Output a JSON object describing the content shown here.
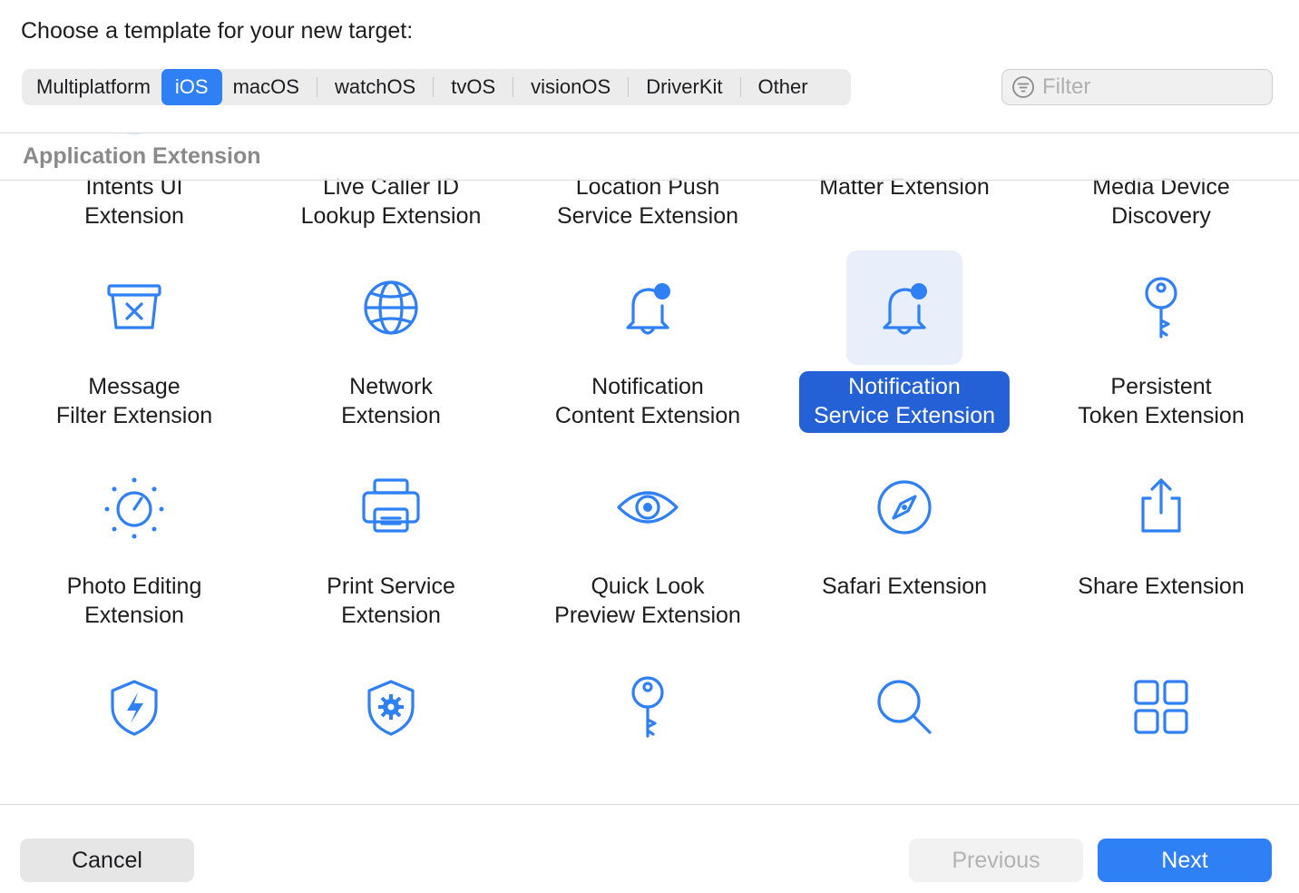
{
  "heading": "Choose a template for your new target:",
  "platform_tabs": [
    {
      "label": "Multiplatform",
      "selected": false
    },
    {
      "label": "iOS",
      "selected": true
    },
    {
      "label": "macOS",
      "selected": false
    },
    {
      "label": "watchOS",
      "selected": false
    },
    {
      "label": "tvOS",
      "selected": false
    },
    {
      "label": "visionOS",
      "selected": false
    },
    {
      "label": "DriverKit",
      "selected": false
    },
    {
      "label": "Other",
      "selected": false
    }
  ],
  "filter": {
    "placeholder": "Filter",
    "value": ""
  },
  "section": {
    "title": "Application Extension"
  },
  "templates": [
    {
      "lines": [
        "Intents UI",
        "Extension"
      ],
      "icon": "intents-ui-icon"
    },
    {
      "lines": [
        "Live Caller ID",
        "Lookup Extension"
      ],
      "icon": "caller-id-icon"
    },
    {
      "lines": [
        "Location Push",
        "Service Extension"
      ],
      "icon": "location-arrow-icon"
    },
    {
      "lines": [
        "Matter Extension"
      ],
      "icon": "matter-icon"
    },
    {
      "lines": [
        "Media Device",
        "Discovery"
      ],
      "icon": "media-device-icon"
    },
    {
      "lines": [
        "Message",
        "Filter Extension"
      ],
      "icon": "message-filter-icon"
    },
    {
      "lines": [
        "Network",
        "Extension"
      ],
      "icon": "globe-icon"
    },
    {
      "lines": [
        "Notification",
        "Content Extension"
      ],
      "icon": "bell-badge-icon"
    },
    {
      "lines": [
        "Notification",
        "Service Extension"
      ],
      "icon": "bell-badge-icon",
      "selected": true
    },
    {
      "lines": [
        "Persistent",
        "Token Extension"
      ],
      "icon": "key-icon"
    },
    {
      "lines": [
        "Photo Editing",
        "Extension"
      ],
      "icon": "photo-editing-icon"
    },
    {
      "lines": [
        "Print Service",
        "Extension"
      ],
      "icon": "printer-icon"
    },
    {
      "lines": [
        "Quick Look",
        "Preview Extension"
      ],
      "icon": "eye-icon"
    },
    {
      "lines": [
        "Safari Extension"
      ],
      "icon": "compass-icon"
    },
    {
      "lines": [
        "Share Extension"
      ],
      "icon": "share-icon"
    },
    {
      "lines": [],
      "icon": "shield-bolt-icon"
    },
    {
      "lines": [],
      "icon": "shield-gear-icon"
    },
    {
      "lines": [],
      "icon": "key-icon"
    },
    {
      "lines": [],
      "icon": "magnifier-icon"
    },
    {
      "lines": [],
      "icon": "grid-icon"
    }
  ],
  "buttons": {
    "cancel": "Cancel",
    "previous": "Previous",
    "next": "Next"
  },
  "colors": {
    "accent": "#2f7ff5",
    "selected_label": "#2461d7",
    "icon": "#2f7ff5"
  }
}
